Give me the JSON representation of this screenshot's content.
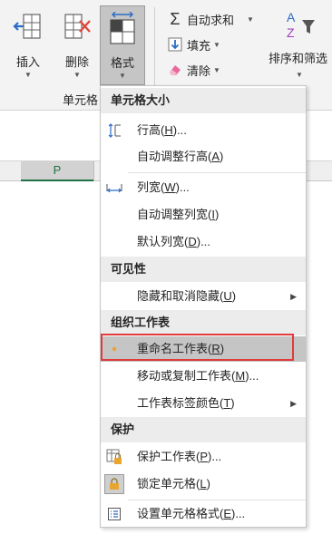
{
  "ribbon": {
    "insert_label": "插入",
    "delete_label": "删除",
    "format_label": "格式",
    "cells_group_label": "单元格",
    "autosum_label": "自动求和",
    "fill_label": "填充",
    "clear_label": "清除",
    "sort_filter_label": "排序和筛选"
  },
  "sheet": {
    "column_header": "P"
  },
  "menu": {
    "sections": [
      {
        "header": "单元格大小",
        "items": [
          {
            "text": "行高(",
            "key": "H",
            "suffix": ")...",
            "icon": "row-height-icon"
          },
          {
            "text": "自动调整行高(",
            "key": "A",
            "suffix": ")",
            "icon": ""
          },
          {
            "text": "列宽(",
            "key": "W",
            "suffix": ")...",
            "icon": "column-width-icon"
          },
          {
            "text": "自动调整列宽(",
            "key": "I",
            "suffix": ")",
            "icon": ""
          },
          {
            "text": "默认列宽(",
            "key": "D",
            "suffix": ")...",
            "icon": ""
          }
        ]
      },
      {
        "header": "可见性",
        "items": [
          {
            "text": "隐藏和取消隐藏(",
            "key": "U",
            "suffix": ")",
            "icon": "",
            "submenu": true
          }
        ]
      },
      {
        "header": "组织工作表",
        "items": [
          {
            "text": "重命名工作表(",
            "key": "R",
            "suffix": ")",
            "icon": "bullet-icon",
            "selected": true
          },
          {
            "text": "移动或复制工作表(",
            "key": "M",
            "suffix": ")...",
            "icon": ""
          },
          {
            "text": "工作表标签颜色(",
            "key": "T",
            "suffix": ")",
            "icon": "",
            "submenu": true
          }
        ]
      },
      {
        "header": "保护",
        "items": [
          {
            "text": "保护工作表(",
            "key": "P",
            "suffix": ")...",
            "icon": "protect-sheet-icon"
          },
          {
            "text": "锁定单元格(",
            "key": "L",
            "suffix": ")",
            "icon": "lock-cell-icon"
          },
          {
            "text": "设置单元格格式(",
            "key": "E",
            "suffix": ")...",
            "icon": "format-cells-icon"
          }
        ]
      }
    ]
  },
  "colors": {
    "accent_green": "#217346",
    "highlight_red": "#e03a3a",
    "bullet_orange": "#f0a030"
  }
}
